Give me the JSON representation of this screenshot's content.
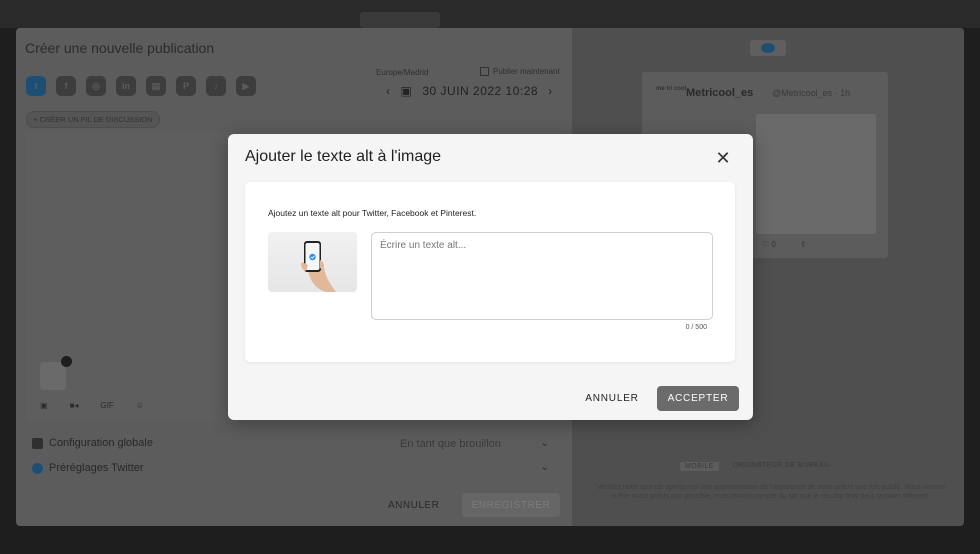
{
  "background": {
    "panel_title": "Créer une nouvelle publication",
    "networks": [
      {
        "icon": "twitter-icon",
        "glyph": "t"
      },
      {
        "icon": "facebook-icon",
        "glyph": "f"
      },
      {
        "icon": "instagram-icon",
        "glyph": "◎"
      },
      {
        "icon": "linkedin-icon",
        "glyph": "in"
      },
      {
        "icon": "google-business-icon",
        "glyph": "▤"
      },
      {
        "icon": "pinterest-icon",
        "glyph": "P"
      },
      {
        "icon": "tiktok-icon",
        "glyph": "♪"
      },
      {
        "icon": "youtube-icon",
        "glyph": "▶"
      }
    ],
    "timezone": "Europe/Madrid",
    "publish_now": "Publier maintenant",
    "date": "30 JUIN 2022 10:28",
    "thread_button": "+ CRÉER UN FIL DE DISCUSSION",
    "media_tools": [
      "▣",
      "■◂",
      "GIF",
      "☺"
    ],
    "global_config": "Configuration globale",
    "twitter_presets": "Préréglages Twitter",
    "draft_label": "En tant que brouillon",
    "cancel": "ANNULER",
    "save": "ENREGISTRER",
    "preview": {
      "account_name": "Metricool_es",
      "account_handle": "@Metricool_es · 1h",
      "logo_text": "me tri cool",
      "likes": "♡ 0",
      "mobile": "MOBILE",
      "desktop": "ORDINATEUR DE BUREAU",
      "disclaimer": "Veuillez noter que cet aperçu est une approximation de l'apparence de votre article une fois publié. Nous venons à être aussi précis que possible, mais tenons compte du fait que le résultat final peut sembler différent."
    }
  },
  "modal": {
    "title": "Ajouter le texte alt à l'image",
    "description": "Ajoutez un texte alt pour Twitter, Facebook et Pinterest.",
    "textarea_placeholder": "Écrire un texte alt...",
    "textarea_value": "",
    "char_count": "0 / 500",
    "cancel_label": "ANNULER",
    "accept_label": "ACCEPTER"
  },
  "colors": {
    "accent_dark": "#6b6b6b",
    "twitter_blue": "#1da1f2",
    "modal_bg": "#f5f5f5"
  }
}
